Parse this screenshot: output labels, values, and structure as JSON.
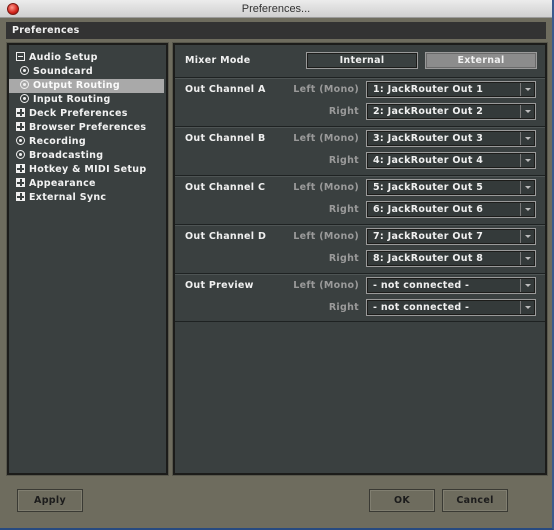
{
  "window": {
    "title": "Preferences..."
  },
  "header": {
    "title": "Preferences"
  },
  "sidebar": {
    "items": [
      {
        "label": "Audio Setup",
        "icon": "minus-box-icon",
        "level": 0,
        "selected": false
      },
      {
        "label": "Soundcard",
        "icon": "radio-icon",
        "level": 1,
        "selected": false
      },
      {
        "label": "Output Routing",
        "icon": "radio-icon",
        "level": 1,
        "selected": true
      },
      {
        "label": "Input Routing",
        "icon": "radio-icon",
        "level": 1,
        "selected": false
      },
      {
        "label": "Deck Preferences",
        "icon": "plus-box-icon",
        "level": 0,
        "selected": false
      },
      {
        "label": "Browser Preferences",
        "icon": "plus-box-icon",
        "level": 0,
        "selected": false
      },
      {
        "label": "Recording",
        "icon": "radio-icon",
        "level": 0,
        "selected": false
      },
      {
        "label": "Broadcasting",
        "icon": "radio-icon",
        "level": 0,
        "selected": false
      },
      {
        "label": "Hotkey & MIDI Setup",
        "icon": "plus-box-icon",
        "level": 0,
        "selected": false
      },
      {
        "label": "Appearance",
        "icon": "plus-box-icon",
        "level": 0,
        "selected": false
      },
      {
        "label": "External Sync",
        "icon": "plus-box-icon",
        "level": 0,
        "selected": false
      }
    ]
  },
  "main": {
    "mixer_mode": {
      "label": "Mixer Mode",
      "options": [
        "Internal",
        "External"
      ],
      "selected": "External"
    },
    "channels": [
      {
        "name": "Out Channel A",
        "left_label": "Left (Mono)",
        "left_value": "1: JackRouter Out 1",
        "right_label": "Right",
        "right_value": "2: JackRouter Out 2"
      },
      {
        "name": "Out Channel B",
        "left_label": "Left (Mono)",
        "left_value": "3: JackRouter Out 3",
        "right_label": "Right",
        "right_value": "4: JackRouter Out 4"
      },
      {
        "name": "Out Channel C",
        "left_label": "Left (Mono)",
        "left_value": "5: JackRouter Out 5",
        "right_label": "Right",
        "right_value": "6: JackRouter Out 6"
      },
      {
        "name": "Out Channel D",
        "left_label": "Left (Mono)",
        "left_value": "7: JackRouter Out 7",
        "right_label": "Right",
        "right_value": "8: JackRouter Out 8"
      },
      {
        "name": "Out Preview",
        "left_label": "Left (Mono)",
        "left_value": "- not connected -",
        "right_label": "Right",
        "right_value": "- not connected -"
      }
    ]
  },
  "footer": {
    "apply_label": "Apply",
    "ok_label": "OK",
    "cancel_label": "Cancel"
  }
}
